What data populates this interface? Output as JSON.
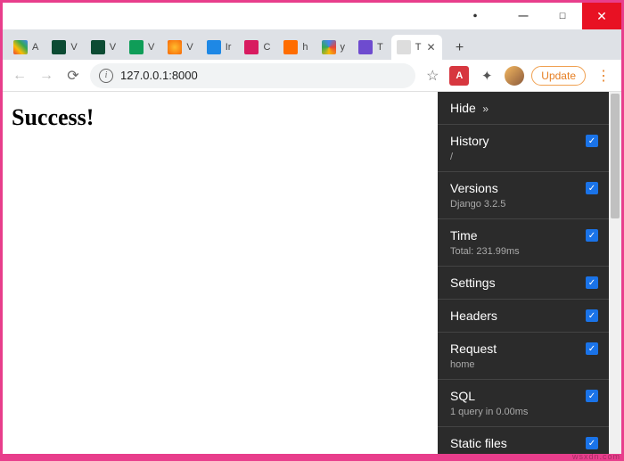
{
  "window": {
    "close": "✕",
    "max": "☐",
    "min": "—",
    "record": "⏺"
  },
  "tabs": [
    {
      "label": "A",
      "fav_bg": "linear-gradient(45deg,#ea4335,#fbbc05,#34a853,#4285f4)"
    },
    {
      "label": "V",
      "fav_bg": "#0c4b33"
    },
    {
      "label": "V",
      "fav_bg": "#0c4b33"
    },
    {
      "label": "V",
      "fav_bg": "#0f9d58"
    },
    {
      "label": "V",
      "fav_bg": "radial-gradient(circle,#ffbd2e,#f76707)"
    },
    {
      "label": "Ir",
      "fav_bg": "#1e88e5"
    },
    {
      "label": "C",
      "fav_bg": "#d81b60"
    },
    {
      "label": "h",
      "fav_bg": "#ff6d00"
    },
    {
      "label": "y",
      "fav_bg": "conic-gradient(#4285f4,#ea4335,#fbbc05,#34a853,#4285f4)"
    },
    {
      "label": "T",
      "fav_bg": "#6e4bcf"
    }
  ],
  "active_tab": {
    "label": "T",
    "fav_bg": "#ccc"
  },
  "newtab": "+",
  "address": {
    "url": "127.0.0.1:8000",
    "star": "☆",
    "adobe": "A",
    "puzzle": "✦",
    "update": "Update",
    "menu": "⋮"
  },
  "page": {
    "heading": "Success!"
  },
  "toolbar": {
    "hide": "Hide",
    "hide_arrow": "»",
    "panels": [
      {
        "title": "History",
        "sub": "/",
        "checked": true
      },
      {
        "title": "Versions",
        "sub": "Django 3.2.5",
        "checked": true
      },
      {
        "title": "Time",
        "sub": "Total: 231.99ms",
        "checked": true
      },
      {
        "title": "Settings",
        "sub": "",
        "checked": true
      },
      {
        "title": "Headers",
        "sub": "",
        "checked": true
      },
      {
        "title": "Request",
        "sub": "home",
        "checked": true
      },
      {
        "title": "SQL",
        "sub": "1 query in 0.00ms",
        "checked": true
      },
      {
        "title": "Static files",
        "sub": "",
        "checked": true
      }
    ]
  },
  "watermark": "wsxdn.com"
}
